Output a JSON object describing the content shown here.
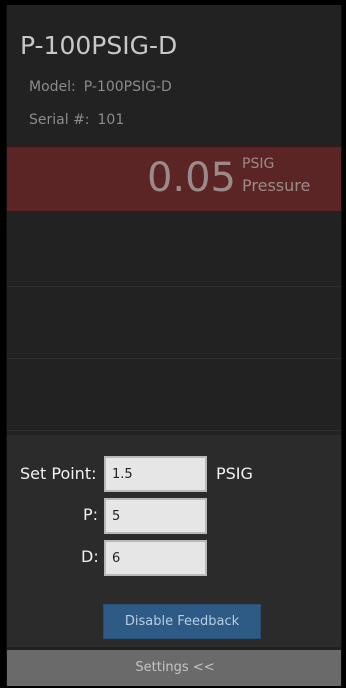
{
  "device": {
    "title": "P-100PSIG-D",
    "model_label": "Model:",
    "model_value": "P-100PSIG-D",
    "serial_label": "Serial #:",
    "serial_value": "101"
  },
  "reading": {
    "value": "0.05",
    "unit": "PSIG",
    "label": "Pressure"
  },
  "controls": {
    "setpoint_label": "Set Point:",
    "setpoint_value": "1.5",
    "setpoint_unit": "PSIG",
    "p_label": "P:",
    "p_value": "5",
    "d_label": "D:",
    "d_value": "6",
    "feedback_button": "Disable Feedback"
  },
  "footer": {
    "settings_label": "Settings <<"
  },
  "colors": {
    "panel_bg": "#222222",
    "pressure_band": "#5b2525",
    "button_blue": "#2d5b86",
    "settings_bar": "#6a6a6a"
  }
}
